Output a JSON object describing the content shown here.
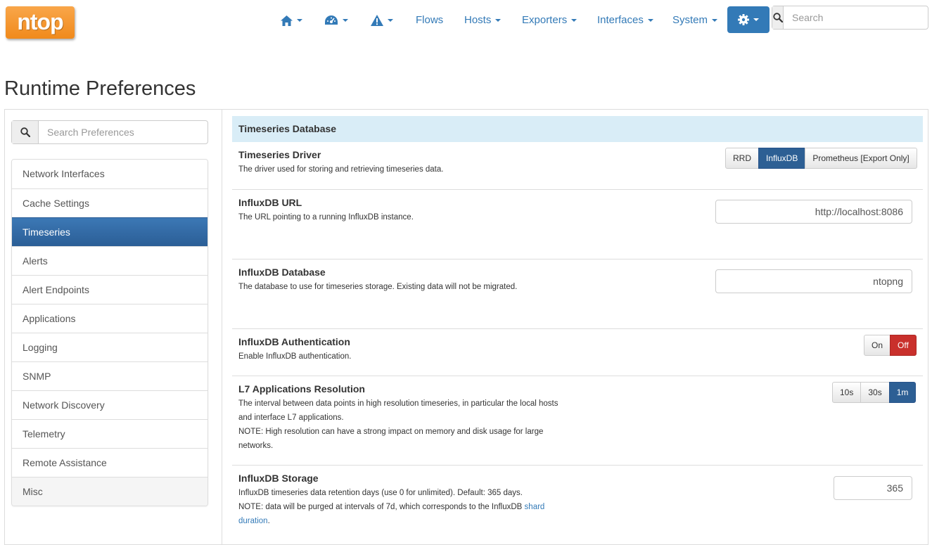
{
  "brand": {
    "logo_text": "ntop"
  },
  "nav": {
    "items": [
      "Flows",
      "Hosts",
      "Exporters",
      "Interfaces",
      "System"
    ],
    "search_placeholder": "Search"
  },
  "page": {
    "title": "Runtime Preferences"
  },
  "sidebar": {
    "search_placeholder": "Search Preferences",
    "items": [
      {
        "label": "Network Interfaces"
      },
      {
        "label": "Cache Settings"
      },
      {
        "label": "Timeseries",
        "active": true
      },
      {
        "label": "Alerts"
      },
      {
        "label": "Alert Endpoints"
      },
      {
        "label": "Applications"
      },
      {
        "label": "Logging"
      },
      {
        "label": "SNMP"
      },
      {
        "label": "Network Discovery"
      },
      {
        "label": "Telemetry"
      },
      {
        "label": "Remote Assistance"
      },
      {
        "label": "Misc"
      }
    ]
  },
  "section": {
    "title": "Timeseries Database",
    "prefs": {
      "driver": {
        "title": "Timeseries Driver",
        "desc": "The driver used for storing and retrieving timeseries data.",
        "options": [
          "RRD",
          "InfluxDB",
          "Prometheus [Export Only]"
        ],
        "selected": "InfluxDB"
      },
      "url": {
        "title": "InfluxDB URL",
        "desc": "The URL pointing to a running InfluxDB instance.",
        "value": "http://localhost:8086"
      },
      "database": {
        "title": "InfluxDB Database",
        "desc": "The database to use for timeseries storage. Existing data will not be migrated.",
        "value": "ntopng"
      },
      "auth": {
        "title": "InfluxDB Authentication",
        "desc": "Enable InfluxDB authentication.",
        "options": [
          "On",
          "Off"
        ],
        "selected": "Off"
      },
      "l7_resolution": {
        "title": "L7 Applications Resolution",
        "desc_line1": "The interval between data points in high resolution timeseries, in particular the local hosts and interface L7 applications.",
        "desc_line2": "NOTE: High resolution can have a strong impact on memory and disk usage for large networks.",
        "options": [
          "10s",
          "30s",
          "1m"
        ],
        "selected": "1m"
      },
      "storage": {
        "title": "InfluxDB Storage",
        "desc_line1": "InfluxDB timeseries data retention days (use 0 for unlimited). Default: 365 days.",
        "desc_line2_prefix": "NOTE: data will be purged at intervals of 7d, which corresponds to the InfluxDB",
        "desc_link": "shard duration",
        "desc_line2_suffix": ".",
        "value": "365"
      }
    }
  },
  "colors": {
    "primary": "#337ab7",
    "active_nav": "#2d5f94",
    "danger": "#c9302c",
    "section_header_bg": "#d9edf7",
    "logo_orange": "#f39a33"
  }
}
